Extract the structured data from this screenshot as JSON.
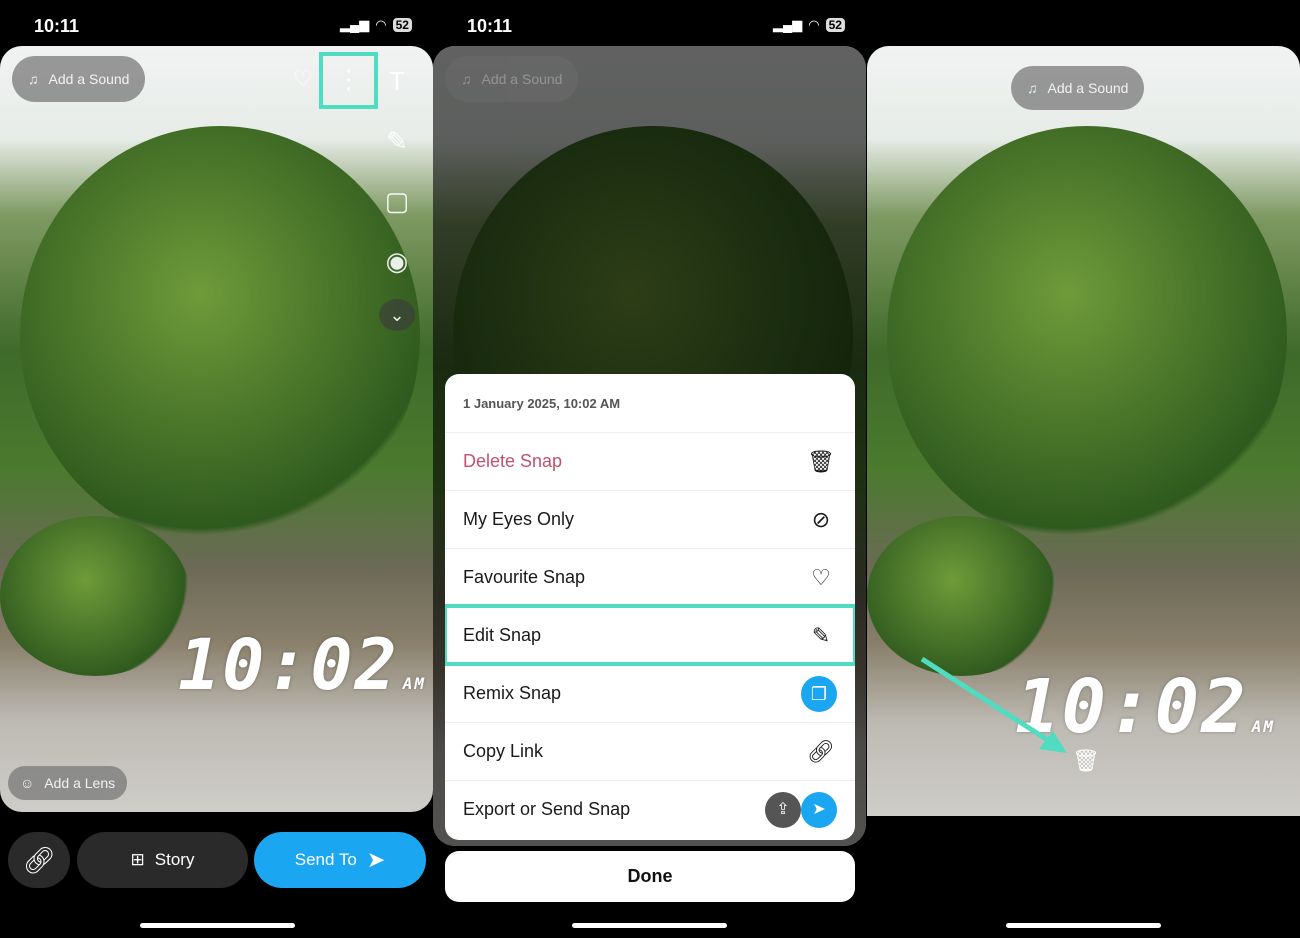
{
  "status": {
    "time": "10:11",
    "battery": "52"
  },
  "panel1": {
    "add_sound": "Add a Sound",
    "add_lens": "Add a Lens",
    "clock": "10:02",
    "clock_ampm": "AM",
    "story_label": "Story",
    "send_label": "Send To",
    "icons": [
      "heart-icon",
      "more-vertical-icon",
      "text-icon",
      "pencil-icon",
      "sticker-icon",
      "camera-icon",
      "chevron-down-icon"
    ]
  },
  "panel2": {
    "add_sound": "Add a Sound",
    "menu": {
      "header": "1 January 2025, 10:02 AM",
      "items": [
        {
          "label": "Delete Snap",
          "icon": "trash-icon",
          "color": "#c2506e"
        },
        {
          "label": "My Eyes Only",
          "icon": "eye-off-icon"
        },
        {
          "label": "Favourite Snap",
          "icon": "heart-icon"
        },
        {
          "label": "Edit Snap",
          "icon": "pencil-icon",
          "highlighted": true
        },
        {
          "label": "Remix Snap",
          "icon": "remix-icon"
        },
        {
          "label": "Copy Link",
          "icon": "link-icon"
        },
        {
          "label": "Export or Send Snap",
          "icon": "export-icon"
        }
      ]
    },
    "done": "Done"
  },
  "panel3": {
    "add_sound": "Add a Sound",
    "clock": "10:02",
    "clock_ampm": "AM"
  },
  "colors": {
    "highlight": "#4fdcc0",
    "accent": "#1aa6f0",
    "delete": "#c2506e"
  }
}
